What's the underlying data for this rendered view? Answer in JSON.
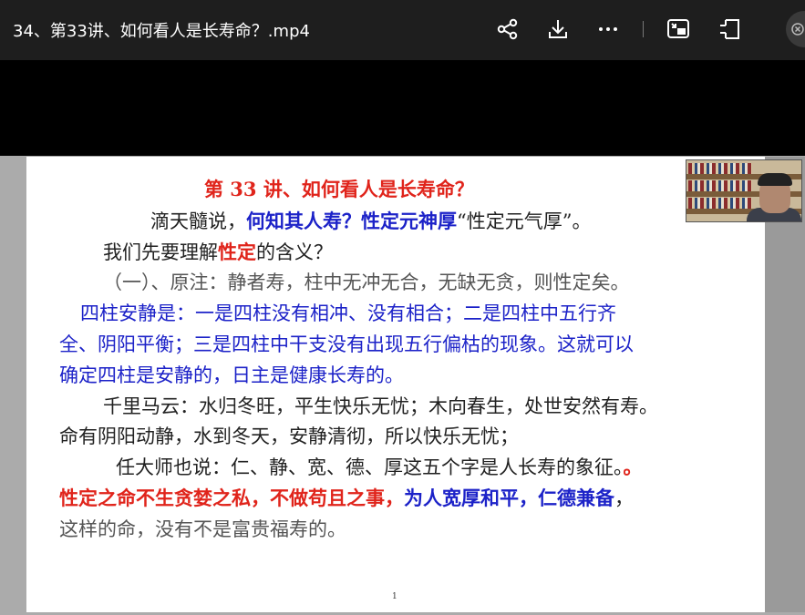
{
  "window": {
    "title": "34、第33讲、如何看人是长寿命？.mp4"
  },
  "toolbar": {
    "icons": [
      "share-icon",
      "download-icon",
      "more-icon",
      "picture-in-picture-icon",
      "fullscreen-icon"
    ]
  },
  "slide": {
    "heading": "第 33 讲、如何看人是长寿命？",
    "p1_a": "滴天髓说，",
    "p1_b": "何知其人寿？性定元神厚",
    "p1_c": "“性定元气厚”。",
    "p2_a": "我们先要理解",
    "p2_b": "性定",
    "p2_c": "的含义？",
    "p3": "（一）、原注：静者寿，柱中无冲无合，无缺无贪，则性定矣。",
    "p4_l1": "四柱安静是：一是四柱没有相冲、没有相合；二是四柱中五行齐",
    "p4_l2": "全、阴阳平衡；三是四柱中干支没有出现五行偏枯的现象。这就可以",
    "p4_l3": "确定四柱是安静的，日主是健康长寿的。",
    "p5_l1": "千里马云：水归冬旺，平生快乐无忧；木向春生，处世安然有寿。",
    "p5_l2": "命有阴阳动静，水到冬天，安静清彻，所以快乐无忧；",
    "p6_a": "任大师也说：仁、静、宽、德、厚这五个字是人长寿的象征。",
    "p6_b": "。",
    "p7_a": "性定之命不生贪婪之私，不做苟且之事，",
    "p7_b": "为人宽厚和平，仁德兼备",
    "p7_c": "，",
    "p8": "这样的命，没有不是富贵福寿的。",
    "page_number": "1"
  },
  "colors": {
    "red": "#e0241b",
    "blue": "#1c22c8",
    "topbar": "#1e1e1e"
  }
}
